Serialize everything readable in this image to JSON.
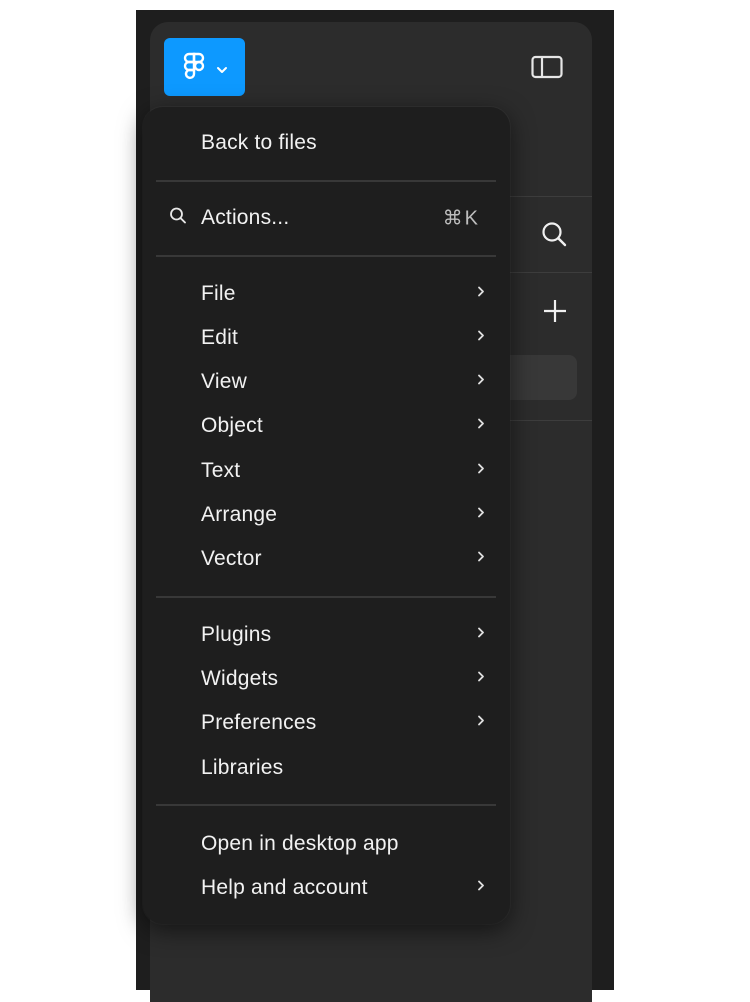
{
  "toolbar": {
    "logo_icon": "figma-logo-icon",
    "chevron_icon": "chevron-down-icon",
    "sidebar_toggle_icon": "sidebar-toggle-icon",
    "accent_color": "#0d99ff"
  },
  "sidebar": {
    "search_icon": "search-icon",
    "add_icon": "plus-icon"
  },
  "menu": {
    "back_to_files": "Back to files",
    "actions": {
      "label": "Actions...",
      "shortcut": "⌘K",
      "icon": "search-icon"
    },
    "groups": [
      [
        {
          "label": "File",
          "has_submenu": true
        },
        {
          "label": "Edit",
          "has_submenu": true
        },
        {
          "label": "View",
          "has_submenu": true
        },
        {
          "label": "Object",
          "has_submenu": true
        },
        {
          "label": "Text",
          "has_submenu": true
        },
        {
          "label": "Arrange",
          "has_submenu": true
        },
        {
          "label": "Vector",
          "has_submenu": true
        }
      ],
      [
        {
          "label": "Plugins",
          "has_submenu": true
        },
        {
          "label": "Widgets",
          "has_submenu": true
        },
        {
          "label": "Preferences",
          "has_submenu": true
        },
        {
          "label": "Libraries",
          "has_submenu": false
        }
      ],
      [
        {
          "label": "Open in desktop app",
          "has_submenu": false
        },
        {
          "label": "Help and account",
          "has_submenu": true
        }
      ]
    ]
  }
}
